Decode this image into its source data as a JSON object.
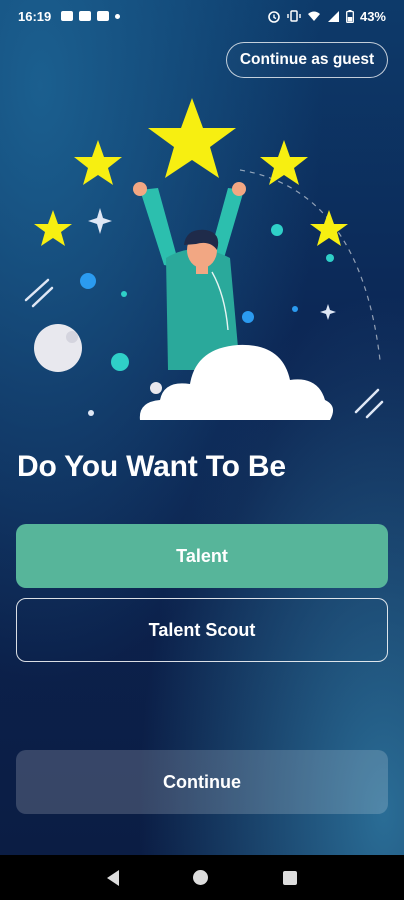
{
  "status_bar": {
    "time": "16:19",
    "left_icons": [
      "notes-icon",
      "youtube-icon",
      "youtube-icon",
      "dot-icon"
    ],
    "right_icons": [
      "alarm-icon",
      "vibrate-icon",
      "wifi-icon",
      "signal-icon",
      "battery-icon"
    ],
    "battery": "43%"
  },
  "header": {
    "guest_label": "Continue as guest"
  },
  "illustration": {
    "icon": "celebrating-person-stars-illustration",
    "colors": {
      "star": "#f7ef11",
      "teal": "#2fd0c8",
      "shirt": "#2cbfae",
      "cloud": "#ffffff",
      "moon": "#e8e8ee"
    }
  },
  "main": {
    "headline": "Do You Want To Be",
    "options": [
      {
        "label": "Talent",
        "selected": true
      },
      {
        "label": "Talent Scout",
        "selected": false
      }
    ],
    "continue_label": "Continue"
  },
  "colors": {
    "selected": "#57b59a",
    "background": "#0c2452"
  },
  "nav": {
    "back_icon": "back-triangle-icon",
    "home_icon": "home-circle-icon",
    "recents_icon": "recents-square-icon"
  }
}
